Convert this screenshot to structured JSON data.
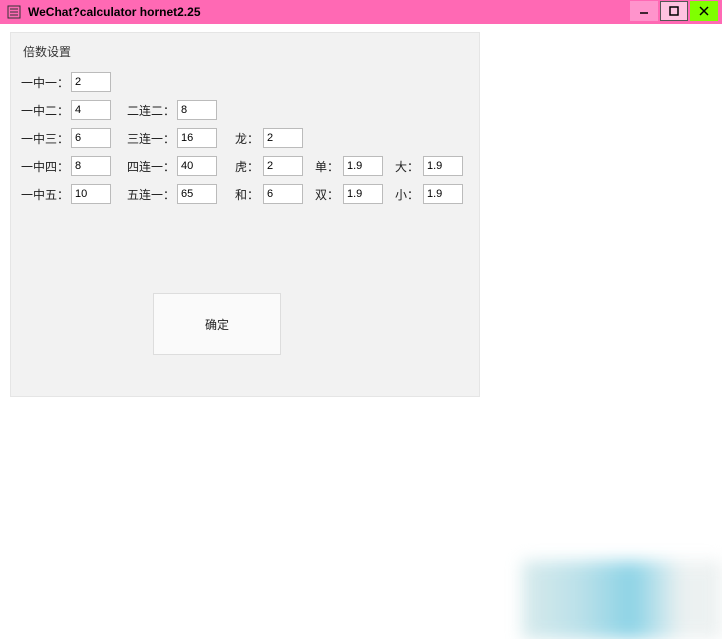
{
  "window": {
    "title": "WeChat?calculator hornet2.25"
  },
  "panel": {
    "title": "倍数设置"
  },
  "labels": {
    "yzy": "一中一：",
    "yze": "一中二：",
    "yzs": "一中三：",
    "yzsi": "一中四：",
    "yzw": "一中五：",
    "ele": "二连二：",
    "sly": "三连一：",
    "sily": "四连一：",
    "wly": "五连一：",
    "long": "龙：",
    "hu": "虎：",
    "he": "和：",
    "dan": "单：",
    "shuang": "双：",
    "da": "大：",
    "xiao": "小："
  },
  "values": {
    "yzy": "2",
    "yze": "4",
    "yzs": "6",
    "yzsi": "8",
    "yzw": "10",
    "ele": "8",
    "sly": "16",
    "sily": "40",
    "wly": "65",
    "long": "2",
    "hu": "2",
    "he": "6",
    "dan": "1.9",
    "shuang": "1.9",
    "da": "1.9",
    "xiao": "1.9"
  },
  "buttons": {
    "confirm": "确定"
  }
}
